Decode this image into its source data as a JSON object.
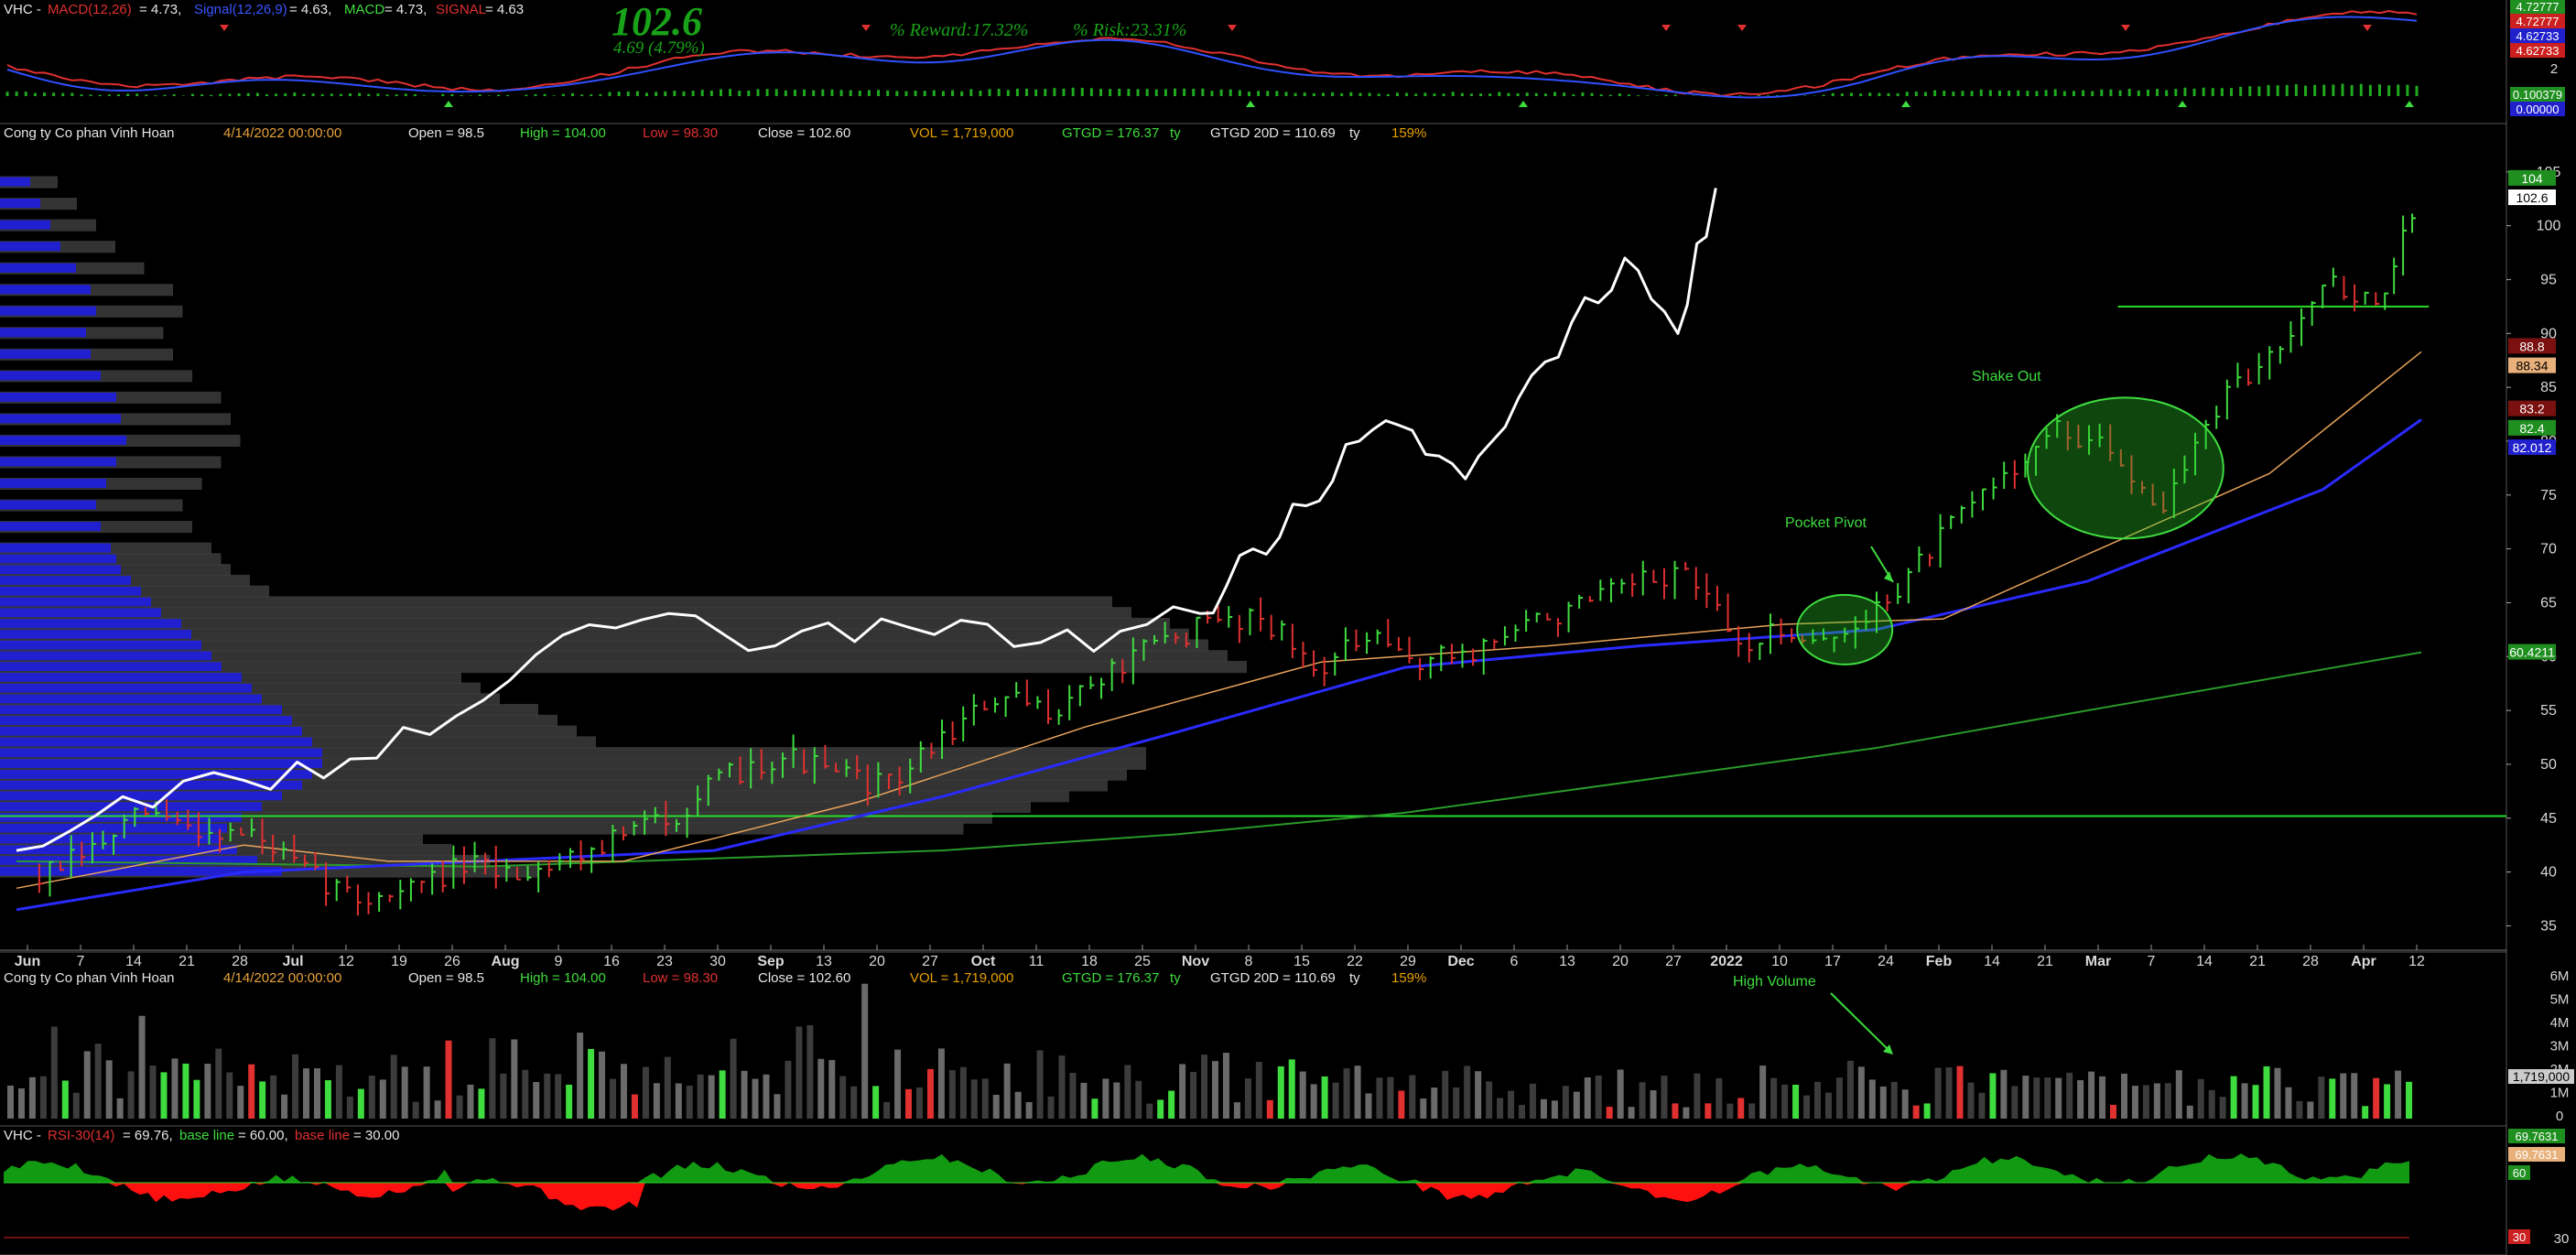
{
  "ticker": "VHC",
  "company": "Cong ty Co phan Vinh Hoan",
  "date_label": "4/14/2022 00:00:00",
  "quote": {
    "open": "Open = 98.5",
    "high": "High = 104.00",
    "low": "Low = 98.30",
    "close": "Close = 102.60",
    "vol": "VOL = 1,719,000",
    "gtgd": "GTGD = 176.37",
    "gtgd_unit": "ty",
    "gtgd20": "GTGD 20D = 110.69",
    "gtgd20_unit": "ty",
    "pct": "159%"
  },
  "big_price": "102.6",
  "change": "4.69 (4.79%)",
  "reward": "% Reward:17.32%",
  "risk": "% Risk:23.31%",
  "macd_legend": {
    "name": "VHC - ",
    "macd_part": "MACD(12,26)",
    "macd_val": " = 4.73, ",
    "signal_part": "Signal(12,26,9)",
    "signal_val": " = 4.63, ",
    "macd2": "MACD",
    "macd2_val": " = 4.73, ",
    "signal2": "SIGNAL",
    "signal2_val": " = 4.63"
  },
  "macd_axis": {
    "ticks": [
      "2"
    ],
    "labels": [
      {
        "text": "4.72777",
        "bg": "#1f8f1f"
      },
      {
        "text": "4.72777",
        "bg": "#cc1f1f"
      },
      {
        "text": "4.62733",
        "bg": "#2020cc"
      },
      {
        "text": "4.62733",
        "bg": "#cc1f1f"
      },
      {
        "text": "0.100379",
        "bg": "#1f8f1f"
      },
      {
        "text": "0.00000",
        "bg": "#2020cc"
      }
    ]
  },
  "price_axis": {
    "ticks": [
      105,
      100,
      95,
      90,
      85,
      80,
      75,
      70,
      65,
      60,
      55,
      50,
      45,
      40,
      35
    ],
    "labels": [
      {
        "text": "104",
        "bg": "#1f8f1f",
        "fg": "#ffffff",
        "v": 104.4
      },
      {
        "text": "102.6",
        "bg": "#ffffff",
        "fg": "#000000",
        "v": 102.6
      },
      {
        "text": "88.8",
        "bg": "#7a1010",
        "fg": "#ffffff",
        "v": 88.8
      },
      {
        "text": "88.34",
        "bg": "#e8b07a",
        "fg": "#000000",
        "v": 87.0
      },
      {
        "text": "83.2",
        "bg": "#7a1010",
        "fg": "#ffffff",
        "v": 83.0
      },
      {
        "text": "82.4",
        "bg": "#1f8f1f",
        "fg": "#ffffff",
        "v": 81.2
      },
      {
        "text": "82.012",
        "bg": "#2020cc",
        "fg": "#ffffff",
        "v": 79.4
      },
      {
        "text": "60.4211",
        "bg": "#1f8f1f",
        "fg": "#ffffff",
        "v": 60.4
      }
    ]
  },
  "x_axis": {
    "labels": [
      {
        "t": "Jun",
        "bold": true
      },
      {
        "t": "7"
      },
      {
        "t": "14"
      },
      {
        "t": "21"
      },
      {
        "t": "28"
      },
      {
        "t": "Jul",
        "bold": true
      },
      {
        "t": "12"
      },
      {
        "t": "19"
      },
      {
        "t": "26"
      },
      {
        "t": "Aug",
        "bold": true
      },
      {
        "t": "9"
      },
      {
        "t": "16"
      },
      {
        "t": "23"
      },
      {
        "t": "30"
      },
      {
        "t": "Sep",
        "bold": true
      },
      {
        "t": "13"
      },
      {
        "t": "20"
      },
      {
        "t": "27"
      },
      {
        "t": "Oct",
        "bold": true
      },
      {
        "t": "11"
      },
      {
        "t": "18"
      },
      {
        "t": "25"
      },
      {
        "t": "Nov",
        "bold": true
      },
      {
        "t": "8"
      },
      {
        "t": "15"
      },
      {
        "t": "22"
      },
      {
        "t": "29"
      },
      {
        "t": "Dec",
        "bold": true
      },
      {
        "t": "6"
      },
      {
        "t": "13"
      },
      {
        "t": "20"
      },
      {
        "t": "27"
      },
      {
        "t": "2022",
        "bold": true
      },
      {
        "t": "10"
      },
      {
        "t": "17"
      },
      {
        "t": "24"
      },
      {
        "t": "Feb",
        "bold": true
      },
      {
        "t": "14"
      },
      {
        "t": "21"
      },
      {
        "t": "Mar",
        "bold": true
      },
      {
        "t": "7"
      },
      {
        "t": "14"
      },
      {
        "t": "21"
      },
      {
        "t": "28"
      },
      {
        "t": "Apr",
        "bold": true
      },
      {
        "t": "12"
      }
    ]
  },
  "annotations": {
    "pocket_pivot": "Pocket Pivot",
    "shake_out": "Shake Out",
    "high_volume": "High Volume"
  },
  "volume_axis": {
    "ticks": [
      "6M",
      "5M",
      "4M",
      "3M",
      "2M",
      "1M",
      "0"
    ],
    "label": "1,719,000"
  },
  "rsi_legend": {
    "name": "VHC - ",
    "rsi": "RSI-30(14)",
    "rsi_val": " = 69.76, ",
    "base1": "base line",
    "base1_val": " = 60.00, ",
    "base2": "base line",
    "base2_val": " = 30.00"
  },
  "rsi_axis": {
    "ticks": [
      "30"
    ],
    "labels": [
      {
        "text": "69.7631",
        "bg": "#1f8f1f"
      },
      {
        "text": "69.7631",
        "bg": "#e8b07a"
      },
      {
        "text": "60",
        "bg": "#1f8f1f"
      },
      {
        "text": "30",
        "bg": "#cc1f1f"
      }
    ]
  },
  "colors": {
    "up": "#3fdc3f",
    "down": "#e03030",
    "ma_orange": "#e8a35a",
    "ma_blue": "#2a2aff",
    "ma_green": "#2a9a2a",
    "rs_line": "#ffffff",
    "profile_grey": "#3c3c3c",
    "profile_blue": "#2020d0",
    "rsi_fill": "#129a12",
    "rsi_below": "#ff1010"
  },
  "chart_data": {
    "type": "line",
    "title": "VHC",
    "date_range": [
      "2021-06-01",
      "2022-04-14"
    ],
    "price_range": [
      33,
      106
    ],
    "price_close_weekly": [
      [
        "2021-06-04",
        39.5
      ],
      [
        "2021-06-11",
        42.0
      ],
      [
        "2021-06-18",
        45.5
      ],
      [
        "2021-06-25",
        44.0
      ],
      [
        "2021-07-02",
        43.5
      ],
      [
        "2021-07-09",
        40.0
      ],
      [
        "2021-07-16",
        37.5
      ],
      [
        "2021-07-23",
        38.5
      ],
      [
        "2021-07-30",
        40.5
      ],
      [
        "2021-08-06",
        40.0
      ],
      [
        "2021-08-13",
        41.5
      ],
      [
        "2021-08-20",
        43.5
      ],
      [
        "2021-08-27",
        45.5
      ],
      [
        "2021-09-03",
        49.0
      ],
      [
        "2021-09-10",
        51.0
      ],
      [
        "2021-09-17",
        49.0
      ],
      [
        "2021-09-24",
        48.0
      ],
      [
        "2021-10-01",
        52.5
      ],
      [
        "2021-10-08",
        56.0
      ],
      [
        "2021-10-15",
        55.0
      ],
      [
        "2021-10-22",
        58.0
      ],
      [
        "2021-10-29",
        61.0
      ],
      [
        "2021-11-05",
        63.0
      ],
      [
        "2021-11-12",
        64.0
      ],
      [
        "2021-11-19",
        59.0
      ],
      [
        "2021-11-26",
        61.5
      ],
      [
        "2021-12-03",
        59.5
      ],
      [
        "2021-12-10",
        60.5
      ],
      [
        "2021-12-17",
        63.0
      ],
      [
        "2021-12-24",
        64.5
      ],
      [
        "2021-12-31",
        66.5
      ],
      [
        "2022-01-07",
        68.0
      ],
      [
        "2022-01-14",
        61.0
      ],
      [
        "2022-01-21",
        62.5
      ],
      [
        "2022-01-28",
        61.5
      ],
      [
        "2022-02-04",
        66.5
      ],
      [
        "2022-02-11",
        72.0
      ],
      [
        "2022-02-18",
        77.0
      ],
      [
        "2022-02-25",
        81.0
      ],
      [
        "2022-03-04",
        79.0
      ],
      [
        "2022-03-11",
        74.0
      ],
      [
        "2022-03-18",
        83.0
      ],
      [
        "2022-03-25",
        88.0
      ],
      [
        "2022-04-01",
        95.0
      ],
      [
        "2022-04-08",
        92.5
      ],
      [
        "2022-04-14",
        102.6
      ]
    ],
    "ma_orange": [
      [
        "2021-06-01",
        38.5
      ],
      [
        "2021-07-01",
        42.5
      ],
      [
        "2021-07-20",
        41.0
      ],
      [
        "2021-08-20",
        41.0
      ],
      [
        "2021-09-20",
        46.5
      ],
      [
        "2021-10-20",
        53.5
      ],
      [
        "2021-11-20",
        59.5
      ],
      [
        "2021-12-20",
        61.0
      ],
      [
        "2022-01-20",
        63.0
      ],
      [
        "2022-02-10",
        63.5
      ],
      [
        "2022-03-01",
        69.5
      ],
      [
        "2022-03-25",
        77.0
      ],
      [
        "2022-04-14",
        88.3
      ]
    ],
    "ma_blue": [
      [
        "2021-06-01",
        36.5
      ],
      [
        "2021-07-01",
        40.0
      ],
      [
        "2021-08-01",
        41.0
      ],
      [
        "2021-09-01",
        42.0
      ],
      [
        "2021-10-01",
        47.0
      ],
      [
        "2021-11-01",
        53.0
      ],
      [
        "2021-12-01",
        59.0
      ],
      [
        "2022-01-01",
        61.0
      ],
      [
        "2022-02-01",
        62.5
      ],
      [
        "2022-03-01",
        67.0
      ],
      [
        "2022-04-01",
        75.5
      ],
      [
        "2022-04-14",
        82.0
      ]
    ],
    "ma_green": [
      [
        "2021-06-01",
        41.0
      ],
      [
        "2021-08-01",
        40.5
      ],
      [
        "2021-10-01",
        42.0
      ],
      [
        "2021-11-01",
        43.5
      ],
      [
        "2021-12-01",
        45.5
      ],
      [
        "2022-01-01",
        48.5
      ],
      [
        "2022-02-01",
        51.5
      ],
      [
        "2022-03-01",
        55.0
      ],
      [
        "2022-04-14",
        60.4
      ]
    ],
    "relative_strength_line": [
      [
        "2021-06-01",
        42.0
      ],
      [
        "2021-06-15",
        47.0
      ],
      [
        "2021-07-01",
        48.5
      ],
      [
        "2021-07-15",
        50.5
      ],
      [
        "2021-07-29",
        54.5
      ],
      [
        "2021-08-12",
        62.0
      ],
      [
        "2021-08-26",
        64.0
      ],
      [
        "2021-09-09",
        61.0
      ],
      [
        "2021-09-23",
        63.5
      ],
      [
        "2021-10-07",
        63.0
      ],
      [
        "2021-10-21",
        60.5
      ],
      [
        "2021-11-04",
        64.0
      ],
      [
        "2021-11-11",
        70.0
      ],
      [
        "2021-11-18",
        74.0
      ],
      [
        "2021-11-25",
        80.0
      ],
      [
        "2021-12-02",
        81.0
      ],
      [
        "2021-12-09",
        76.5
      ],
      [
        "2021-12-16",
        84.0
      ],
      [
        "2021-12-23",
        91.0
      ],
      [
        "2021-12-30",
        97.0
      ],
      [
        "2022-01-06",
        90.0
      ],
      [
        "2022-01-11",
        103.5
      ]
    ],
    "support_line_green": 45.2,
    "shakeout_resistance": 92.5,
    "volume_profile_price_bins": [
      40,
      45,
      50,
      55,
      60,
      65,
      70,
      75,
      80,
      85,
      90,
      95,
      100
    ],
    "volume": {
      "ylabel": "shares",
      "ylim": [
        0,
        6500000
      ],
      "last": 1719000,
      "weekly_avg": [
        [
          "2021-06",
          2400000
        ],
        [
          "2021-07",
          2000000
        ],
        [
          "2021-08",
          2600000
        ],
        [
          "2021-09",
          2900000
        ],
        [
          "2021-10",
          2200000
        ],
        [
          "2021-11",
          2000000
        ],
        [
          "2021-12",
          1700000
        ],
        [
          "2022-01",
          1500000
        ],
        [
          "2022-02",
          1600000
        ],
        [
          "2022-03",
          1700000
        ],
        [
          "2022-04",
          1600000
        ]
      ],
      "spikes": [
        [
          "2021-06-25",
          4800000
        ],
        [
          "2021-08-30",
          6300000
        ],
        [
          "2022-01-27",
          2700000
        ]
      ]
    },
    "macd": {
      "macd": 4.73,
      "signal": 4.63,
      "histogram": 0.100379
    },
    "rsi": {
      "period": 14,
      "value": 69.76,
      "baselines": [
        60,
        30
      ],
      "ylim": [
        25,
        85
      ],
      "monthly": [
        [
          "2021-06",
          67
        ],
        [
          "2021-07",
          53
        ],
        [
          "2021-08",
          67
        ],
        [
          "2021-09",
          62
        ],
        [
          "2021-10",
          68
        ],
        [
          "2021-11",
          66
        ],
        [
          "2021-12",
          59
        ],
        [
          "2022-01",
          58
        ],
        [
          "2022-02",
          66
        ],
        [
          "2022-03",
          67
        ],
        [
          "2022-04",
          69.76
        ]
      ]
    }
  }
}
